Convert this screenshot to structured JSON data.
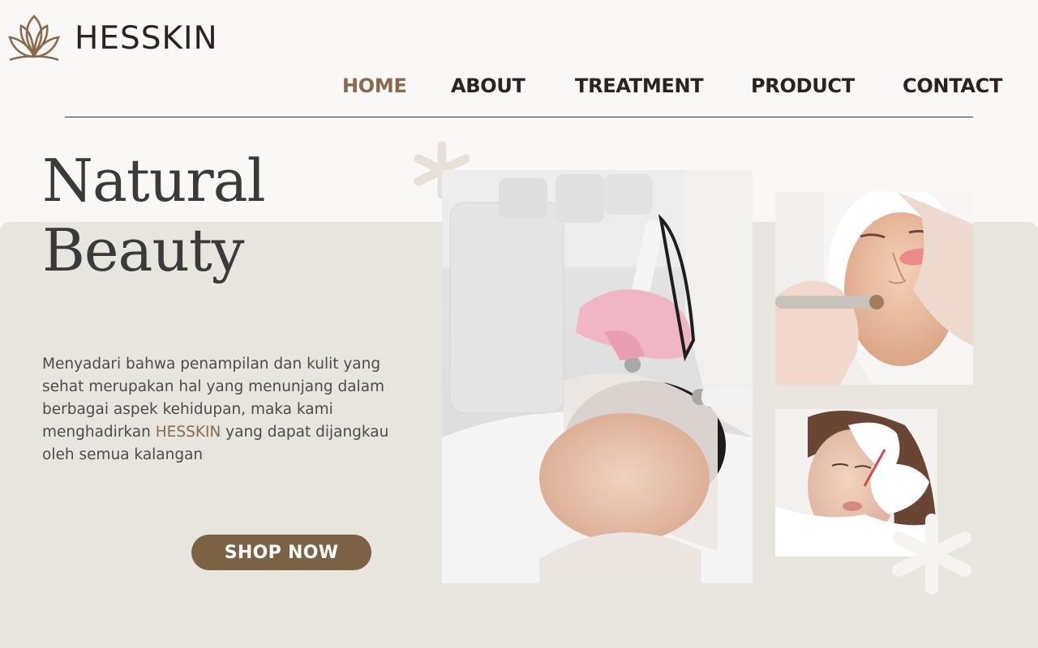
{
  "brand": {
    "name": "HESSKIN",
    "logo_icon": "lotus-icon"
  },
  "nav": {
    "items": [
      {
        "label": "HOME",
        "active": true
      },
      {
        "label": "ABOUT",
        "active": false
      },
      {
        "label": "TREATMENT",
        "active": false
      },
      {
        "label": "PRODUCT",
        "active": false
      },
      {
        "label": "CONTACT",
        "active": false
      }
    ]
  },
  "hero": {
    "title_line1": "Natural",
    "title_line2": "Beauty",
    "description_before": "Menyadari bahwa penampilan dan kulit yang sehat merupakan hal yang menunjang dalam berbagai aspek kehidupan, maka kami menghadirkan ",
    "description_brand": "HESSKIN",
    "description_after": " yang dapat dijangkau oleh semua kalangan",
    "cta_label": "SHOP NOW"
  },
  "images": [
    {
      "icon": "facial-treatment-photo"
    },
    {
      "icon": "microdermabrasion-photo"
    },
    {
      "icon": "injection-treatment-photo"
    }
  ],
  "decorations": {
    "icon": "asterisk-icon"
  },
  "colors": {
    "background": "#f9f8f6",
    "band": "#e8e5df",
    "accent": "#8a6a4f",
    "button": "#7b6244",
    "text_dark": "#2b2320"
  }
}
